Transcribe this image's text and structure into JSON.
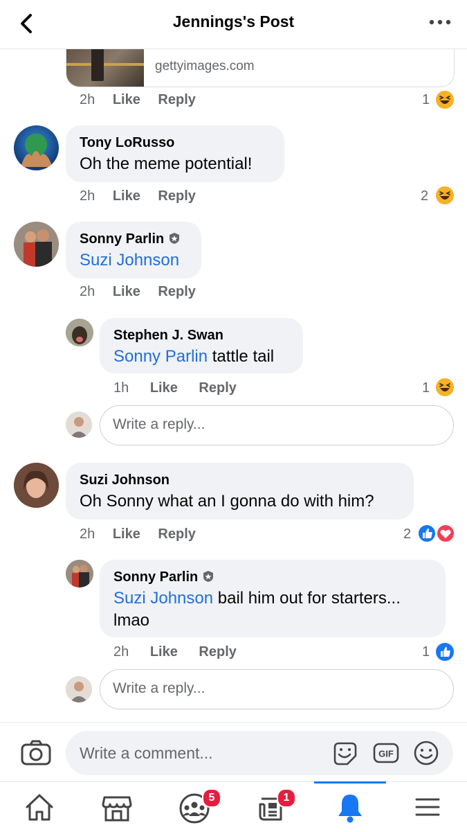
{
  "header": {
    "title": "Jennings's Post"
  },
  "link_preview": {
    "domain": "gettyimages.com"
  },
  "comments": [
    {
      "time": "2h",
      "like": "Like",
      "reply": "Reply",
      "reaction_count": "1"
    },
    {
      "author": "Tony LoRusso",
      "text": "Oh the meme potential!",
      "time": "2h",
      "like": "Like",
      "reply": "Reply",
      "reaction_count": "2"
    },
    {
      "author": "Sonny Parlin",
      "tag": "Suzi Johnson",
      "text": "",
      "time": "2h",
      "like": "Like",
      "reply": "Reply",
      "replies": [
        {
          "author": "Stephen J. Swan",
          "tag": "Sonny Parlin",
          "text": " tattle tail",
          "time": "1h",
          "like": "Like",
          "reply": "Reply",
          "reaction_count": "1"
        }
      ],
      "reply_placeholder": "Write a reply..."
    },
    {
      "author": "Suzi Johnson",
      "text": "Oh Sonny what an I gonna do with him?",
      "time": "2h",
      "like": "Like",
      "reply": "Reply",
      "reaction_count": "2",
      "replies": [
        {
          "author": "Sonny Parlin",
          "tag": "Suzi Johnson",
          "text_line1": " bail him out for starters...",
          "text_line2": "lmao",
          "time": "2h",
          "like": "Like",
          "reply": "Reply",
          "reaction_count": "1"
        }
      ],
      "reply_placeholder": "Write a reply..."
    }
  ],
  "composer": {
    "placeholder": "Write a comment..."
  },
  "tabbar": {
    "groups_badge": "5",
    "news_badge": "1"
  },
  "colors": {
    "accent": "#1877f2",
    "tag": "#216fdb",
    "badge": "#e41e3f",
    "haha": "#f7b125",
    "love": "#f33e58"
  }
}
